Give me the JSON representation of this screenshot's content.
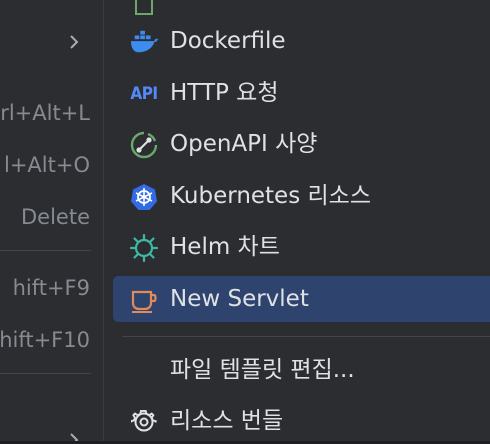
{
  "parent_menu": {
    "shortcuts": [
      {
        "text": "rl+Alt+L"
      },
      {
        "text": "l+Alt+O"
      },
      {
        "text": "Delete"
      },
      {
        "text": "hift+F9"
      },
      {
        "text": "hift+F10"
      }
    ]
  },
  "submenu": {
    "items": [
      {
        "label": "Dockerfile",
        "icon": "docker-icon"
      },
      {
        "label": "HTTP 요청",
        "icon": "api-icon",
        "icon_text": "API"
      },
      {
        "label": "OpenAPI 사양",
        "icon": "openapi-icon"
      },
      {
        "label": "Kubernetes 리소스",
        "icon": "kubernetes-icon"
      },
      {
        "label": "Helm 차트",
        "icon": "helm-icon"
      },
      {
        "label": "New Servlet",
        "icon": "servlet-cup-icon",
        "selected": true
      },
      {
        "label": "파일 템플릿 편집...",
        "icon": ""
      },
      {
        "label": "리소스 번들",
        "icon": "gear-icon"
      }
    ]
  },
  "colors": {
    "background": "#2b2d30",
    "selection": "#2e436e",
    "text": "#dfe1e5",
    "muted_text": "#868a91",
    "docker": "#3d8cf0",
    "api": "#548af7",
    "openapi": "#6aa86b",
    "kubernetes": "#326ce5",
    "helm": "#3fb8a6",
    "servlet": "#e38a5a"
  }
}
